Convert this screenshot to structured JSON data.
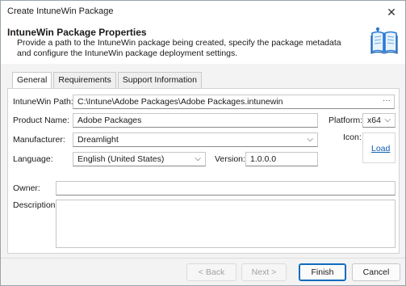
{
  "window": {
    "title": "Create IntuneWin Package",
    "close_glyph": "✕"
  },
  "header": {
    "title": "IntuneWin Package Properties",
    "description": "Provide a path to the IntuneWin package being created, specify the package metadata and configure the IntuneWin package deployment settings.",
    "icon": "book-icon"
  },
  "tabs": [
    {
      "label": "General",
      "active": true
    },
    {
      "label": "Requirements",
      "active": false
    },
    {
      "label": "Support Information",
      "active": false
    }
  ],
  "general": {
    "path_label": "IntuneWin Path:",
    "path_value": "C:\\Intune\\Adobe Packages\\Adobe Packages.intunewin",
    "path_browse": "···",
    "product_label": "Product Name:",
    "product_value": "Adobe Packages",
    "platform_label": "Platform:",
    "platform_value": "x64",
    "manufacturer_label": "Manufacturer:",
    "manufacturer_value": "Dreamlight",
    "icon_label": "Icon:",
    "icon_load": "Load",
    "language_label": "Language:",
    "language_value": "English (United States)",
    "version_label": "Version:",
    "version_value": "1.0.0.0",
    "owner_label": "Owner:",
    "owner_value": "",
    "description_label": "Description:",
    "description_value": ""
  },
  "buttons": {
    "back": "< Back",
    "next": "Next >",
    "finish": "Finish",
    "cancel": "Cancel"
  },
  "dropdown_glyph": "⌵",
  "colors": {
    "link": "#0f5fb0",
    "primary_border": "#0f6cbd"
  }
}
